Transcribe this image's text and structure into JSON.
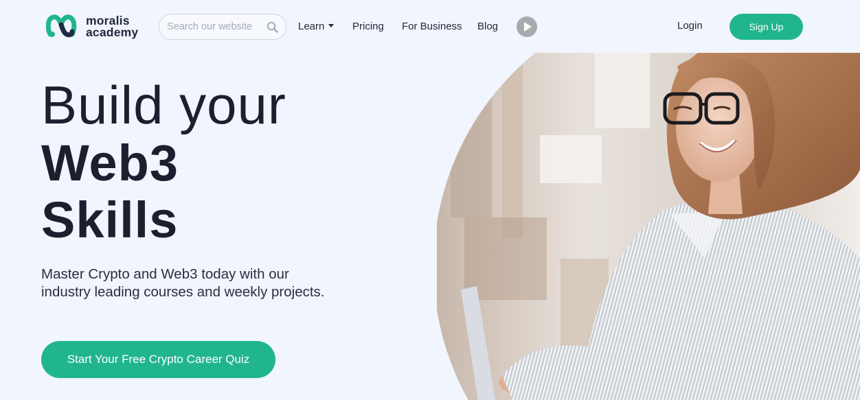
{
  "header": {
    "logo_text_line1": "moralis",
    "logo_text_line2": "academy",
    "search_placeholder": "Search our website",
    "nav": {
      "learn": "Learn",
      "pricing": "Pricing",
      "for_business": "For Business",
      "blog": "Blog"
    },
    "login": "Login",
    "signup": "Sign Up"
  },
  "hero": {
    "line1": "Build your",
    "line2": "Web3",
    "line3": "Skills",
    "subtitle": "Master Crypto and Web3 today with our industry leading courses and weekly projects.",
    "cta": "Start Your Free Crypto Career Quiz"
  },
  "colors": {
    "accent": "#21b58d",
    "background": "#f1f5fe",
    "heading": "#1d1f2e"
  }
}
